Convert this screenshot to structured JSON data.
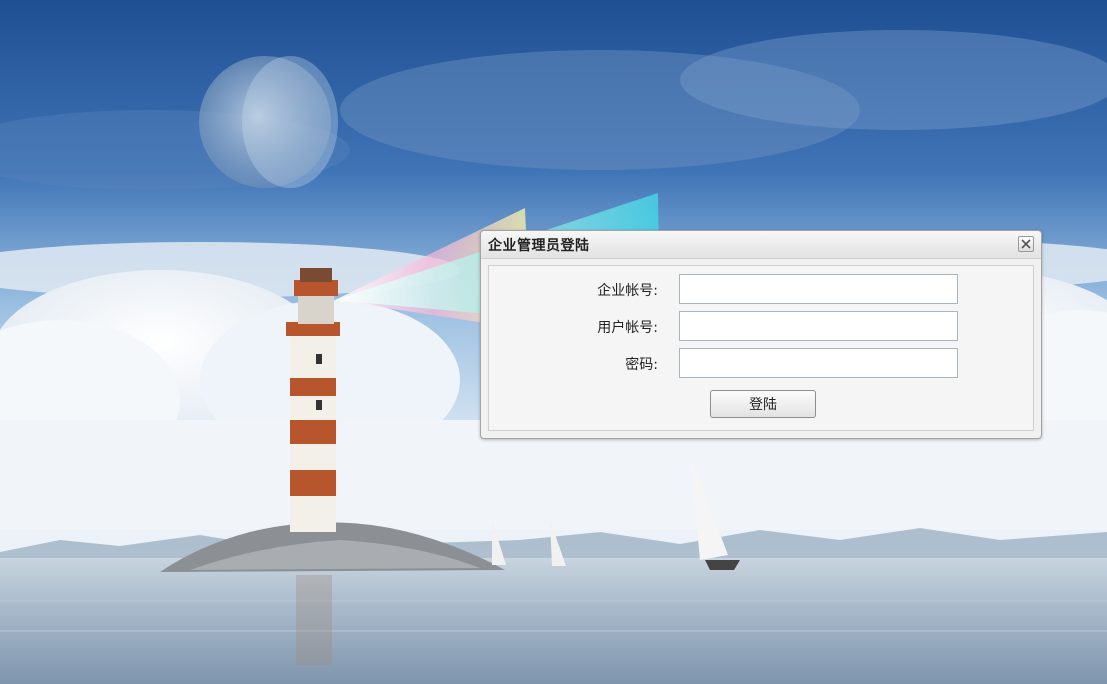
{
  "dialog": {
    "title": "企业管理员登陆",
    "close_icon": "close-icon"
  },
  "form": {
    "fields": [
      {
        "label": "企业帐号:",
        "value": "",
        "placeholder": ""
      },
      {
        "label": "用户帐号:",
        "value": "",
        "placeholder": ""
      },
      {
        "label": "密码:",
        "value": "",
        "placeholder": ""
      }
    ],
    "submit_label": "登陆"
  },
  "colors": {
    "sky_top": "#2c5fa3",
    "sky_mid": "#8fb6dc",
    "sea": "#9eb3c9",
    "lighthouse_stripe": "#b7562c"
  }
}
